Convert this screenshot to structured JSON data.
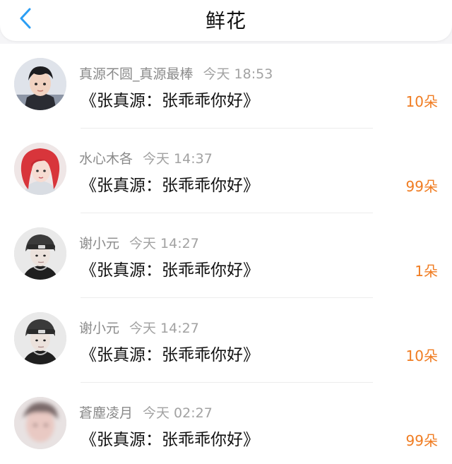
{
  "header": {
    "title": "鲜花",
    "back_icon": "chevron-left-icon",
    "back_color": "#2b9ef4"
  },
  "accent_color": "#f07c21",
  "items": [
    {
      "user": "真源不圆_真源最棒",
      "time": "今天 18:53",
      "work": "《张真源：张乖乖你好》",
      "amount": "10朵",
      "avatar": "avatar-boy-portrait"
    },
    {
      "user": "水心木各",
      "time": "今天 14:37",
      "work": "《张真源：张乖乖你好》",
      "amount": "99朵",
      "avatar": "avatar-red-hair-portrait"
    },
    {
      "user": "谢小元",
      "time": "今天 14:27",
      "work": "《张真源：张乖乖你好》",
      "amount": "1朵",
      "avatar": "avatar-headband-portrait"
    },
    {
      "user": "谢小元",
      "time": "今天 14:27",
      "work": "《张真源：张乖乖你好》",
      "amount": "10朵",
      "avatar": "avatar-headband-portrait"
    },
    {
      "user": "蒼塵凌月",
      "time": "今天 02:27",
      "work": "《张真源：张乖乖你好》",
      "amount": "99朵",
      "avatar": "avatar-blurred-portrait"
    }
  ]
}
